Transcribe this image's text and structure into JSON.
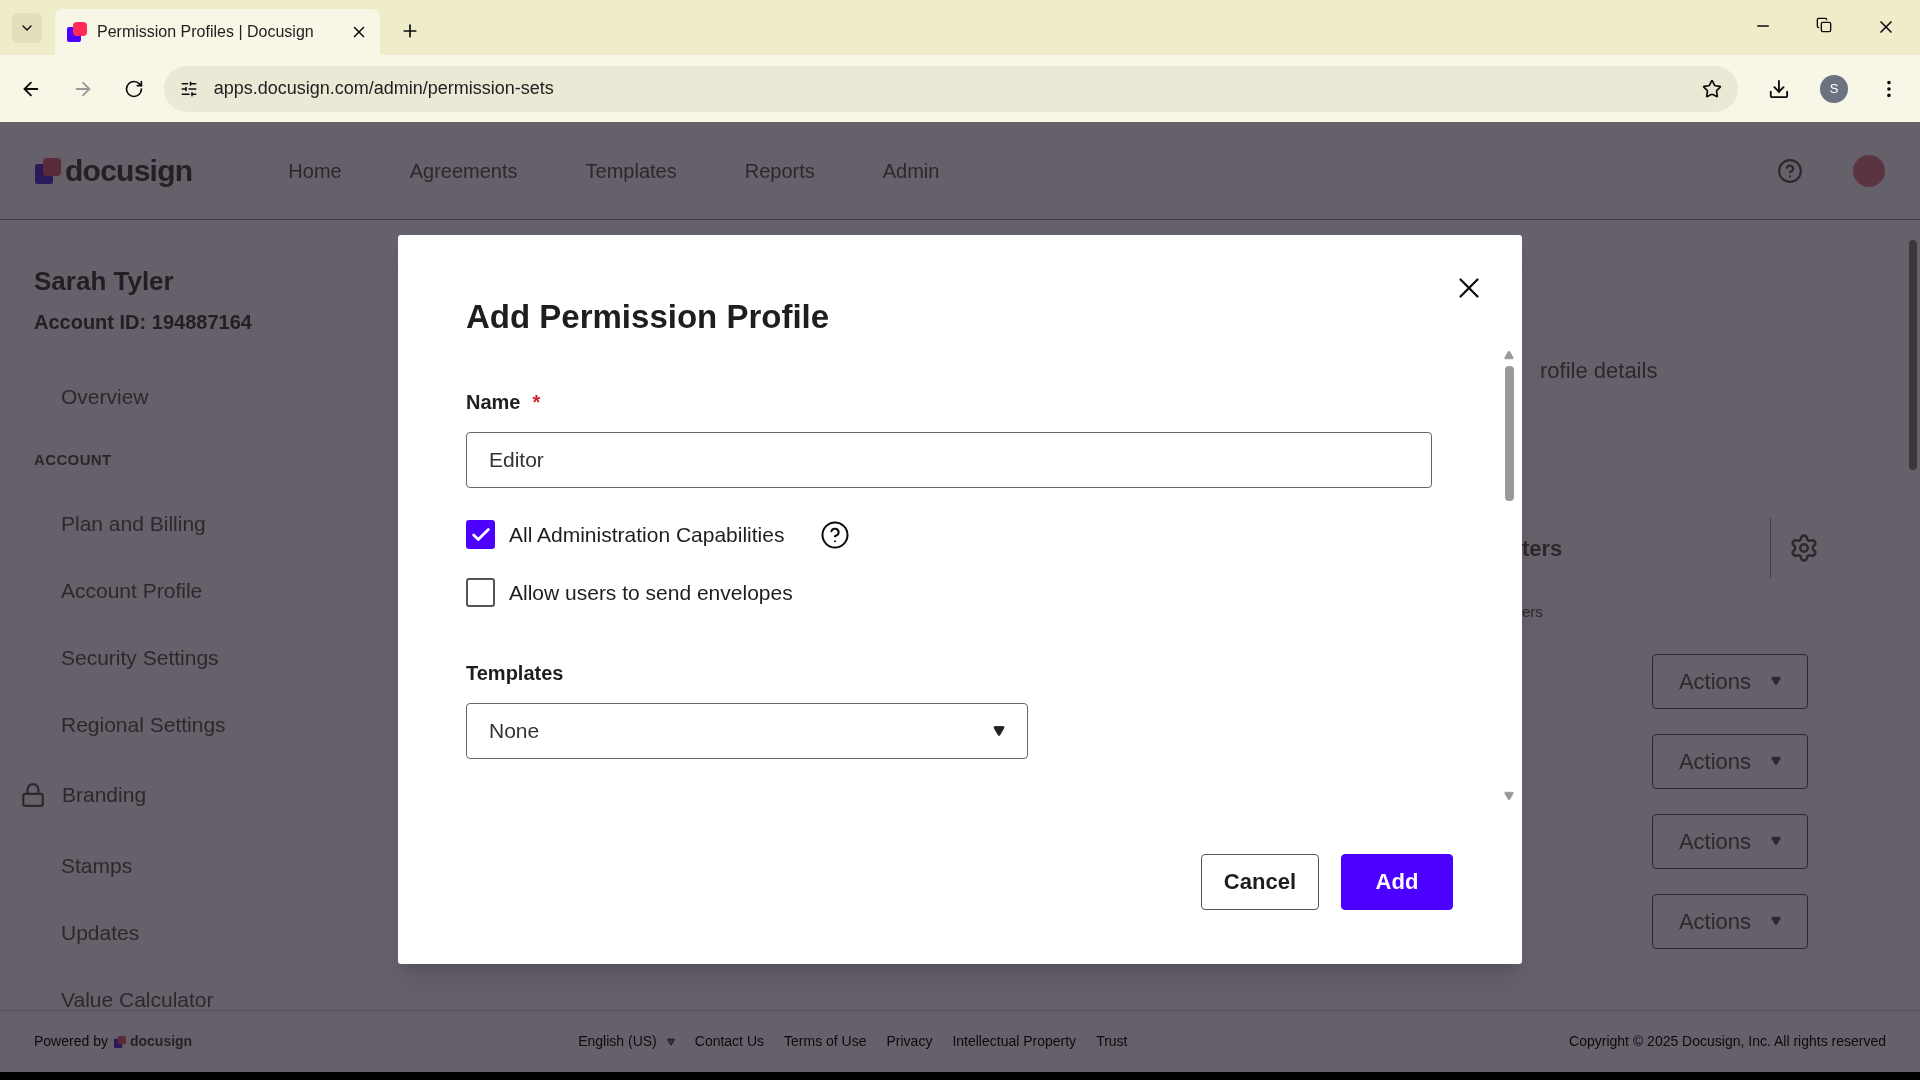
{
  "browser": {
    "tab_title": "Permission Profiles | Docusign",
    "url": "apps.docusign.com/admin/permission-sets",
    "profile_initial": "S"
  },
  "header": {
    "logo": "docusign",
    "nav": [
      "Home",
      "Agreements",
      "Templates",
      "Reports",
      "Admin"
    ]
  },
  "sidebar": {
    "user_name": "Sarah Tyler",
    "account_id": "Account ID: 194887164",
    "items": [
      {
        "kind": "link",
        "label": "Overview"
      },
      {
        "kind": "heading",
        "label": "ACCOUNT"
      },
      {
        "kind": "link",
        "label": "Plan and Billing"
      },
      {
        "kind": "link",
        "label": "Account Profile"
      },
      {
        "kind": "link",
        "label": "Security Settings"
      },
      {
        "kind": "link",
        "label": "Regional Settings"
      },
      {
        "kind": "locked",
        "label": "Branding"
      },
      {
        "kind": "link",
        "label": "Stamps"
      },
      {
        "kind": "link",
        "label": "Updates"
      },
      {
        "kind": "link",
        "label": "Value Calculator"
      }
    ]
  },
  "main": {
    "description_fragment": "rofile details",
    "filter_fragment": "ters",
    "column_fragment": "ers",
    "row_actions": [
      "Actions",
      "Actions",
      "Actions",
      "Actions"
    ]
  },
  "modal": {
    "title": "Add Permission Profile",
    "name_label": "Name",
    "required_mark": "*",
    "name_value": "Editor",
    "checkboxes": [
      {
        "label": "All Administration Capabilities",
        "checked": true,
        "help": true
      },
      {
        "label": "Allow users to send envelopes",
        "checked": false,
        "help": false
      }
    ],
    "templates_label": "Templates",
    "templates_value": "None",
    "buttons": [
      {
        "label": "Cancel",
        "kind": "secondary"
      },
      {
        "label": "Add",
        "kind": "primary"
      }
    ]
  },
  "footer": {
    "powered_by": "Powered by",
    "logo": "docusign",
    "language": "English (US)",
    "links": [
      "Contact Us",
      "Terms of Use",
      "Privacy",
      "Intellectual Property",
      "Trust"
    ],
    "copyright": "Copyright © 2025 Docusign, Inc. All rights reserved"
  }
}
